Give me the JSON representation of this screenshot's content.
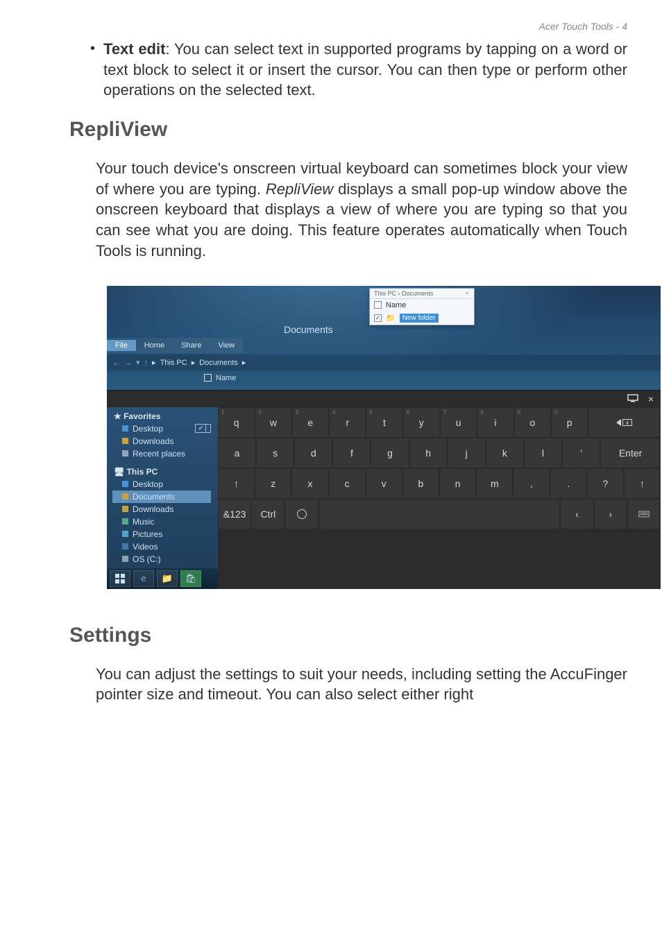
{
  "page_header": "Acer Touch Tools - 4",
  "bullet": {
    "title": "Text edit",
    "body": ": You can select text in supported programs by tapping on a word or text block to select it or insert the cursor. You can then type or perform other operations on the selected text."
  },
  "repliview": {
    "heading": "RepliView",
    "body_before": "Your touch device's onscreen virtual keyboard can sometimes block your view of where you are typing. ",
    "body_em": "RepliView",
    "body_after": " displays a small pop-up window above the onscreen keyboard that displays a view of where you are typing so that you can see what you are doing. This feature operates automatically when Touch Tools is running."
  },
  "settings": {
    "heading": "Settings",
    "body": "You can adjust the settings to suit your needs, including setting the AccuFinger pointer size and timeout. You can also select either right"
  },
  "explorer": {
    "title": "Documents",
    "tabs": [
      "File",
      "Home",
      "Share",
      "View"
    ],
    "breadcrumb": [
      "This PC",
      "Documents"
    ],
    "columns": {
      "name": "Name"
    },
    "sidebar": {
      "favorites_label": "Favorites",
      "favorites": [
        "Desktop",
        "Downloads",
        "Recent places"
      ],
      "thispc_label": "This PC",
      "thispc": [
        "Desktop",
        "Documents",
        "Downloads",
        "Music",
        "Pictures",
        "Videos",
        "OS (C:)"
      ]
    },
    "popup": {
      "breadcrumb": "This PC › Documents",
      "name_header": "Name",
      "sort_caret": "^",
      "new_folder": "New folder",
      "checked": true
    }
  },
  "keyboard": {
    "row1": {
      "keys": [
        "q",
        "w",
        "e",
        "r",
        "t",
        "y",
        "u",
        "i",
        "o",
        "p"
      ],
      "nums": [
        "1",
        "2",
        "3",
        "4",
        "5",
        "6",
        "7",
        "8",
        "9",
        "0"
      ],
      "backspace_char": "x"
    },
    "row2": {
      "keys": [
        "a",
        "s",
        "d",
        "f",
        "g",
        "h",
        "j",
        "k",
        "l",
        "'"
      ],
      "enter": "Enter"
    },
    "row3": {
      "shift": "↑",
      "keys": [
        "z",
        "x",
        "c",
        "v",
        "b",
        "n",
        "m",
        ",",
        "."
      ],
      "q": "?",
      "shift2": "↑"
    },
    "row4": {
      "numpad": "&123",
      "ctrl": "Ctrl",
      "left": "‹",
      "right": "›"
    }
  }
}
